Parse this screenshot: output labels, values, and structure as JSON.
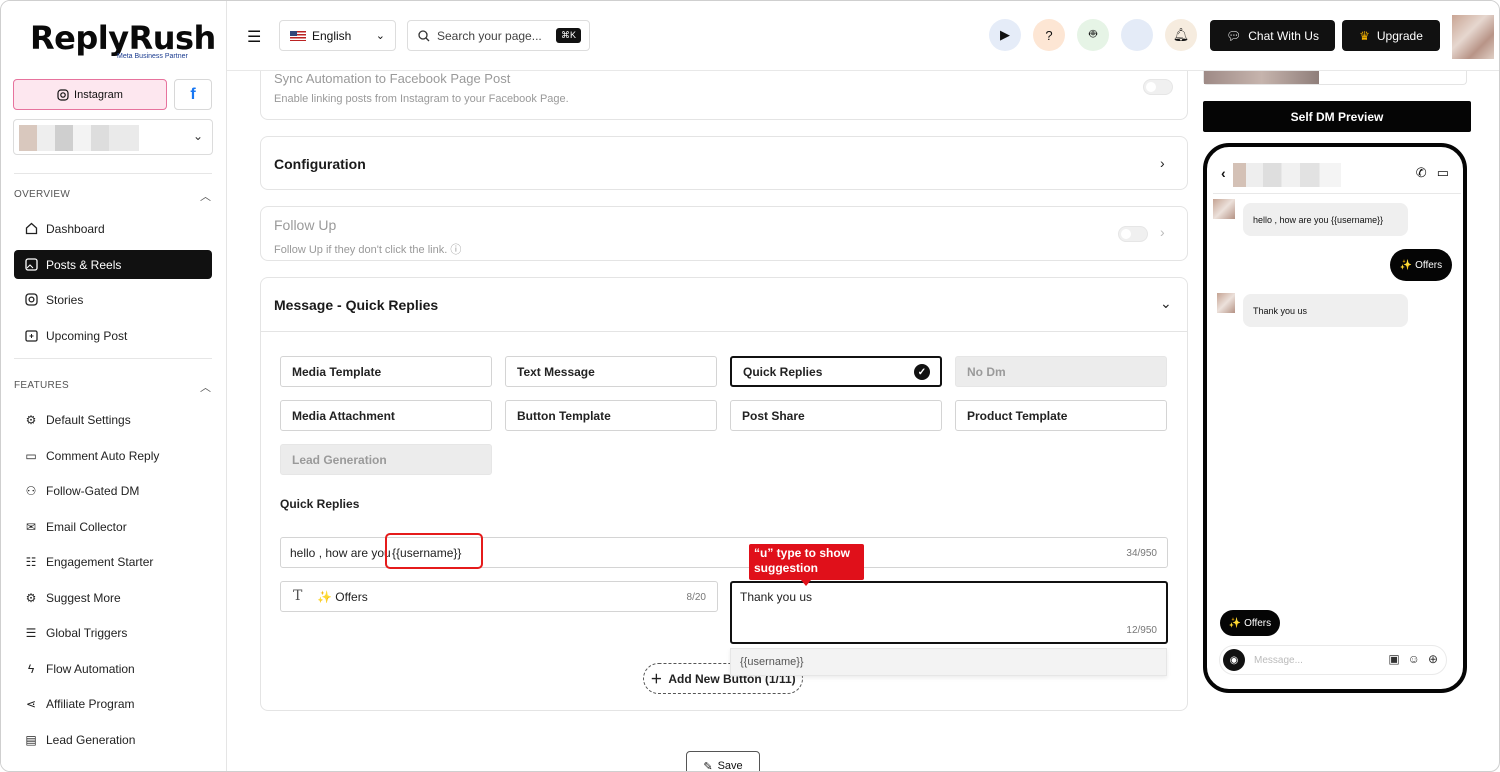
{
  "brand": {
    "name": "ReplyRush",
    "sub": "Meta Business Partner"
  },
  "sidebar": {
    "platform_instagram": "Instagram",
    "platform_facebook": "f",
    "sections": [
      {
        "title": "OVERVIEW"
      },
      {
        "title": "FEATURES"
      }
    ],
    "overview": [
      {
        "label": "Dashboard",
        "icon": "home-icon"
      },
      {
        "label": "Posts & Reels",
        "icon": "image-icon",
        "active": true
      },
      {
        "label": "Stories",
        "icon": "instagram-icon"
      },
      {
        "label": "Upcoming Post",
        "icon": "calendar-icon"
      }
    ],
    "features": [
      {
        "label": "Default Settings",
        "icon": "gear-icon"
      },
      {
        "label": "Comment Auto Reply",
        "icon": "comment-icon"
      },
      {
        "label": "Follow-Gated DM",
        "icon": "users-icon"
      },
      {
        "label": "Email Collector",
        "icon": "mail-icon"
      },
      {
        "label": "Engagement Starter",
        "icon": "chat-icon"
      },
      {
        "label": "Suggest More",
        "icon": "gear-icon"
      },
      {
        "label": "Global Triggers",
        "icon": "list-icon"
      },
      {
        "label": "Flow Automation",
        "icon": "bolt-icon"
      },
      {
        "label": "Affiliate Program",
        "icon": "share-icon"
      },
      {
        "label": "Lead Generation",
        "icon": "doc-icon"
      }
    ]
  },
  "topbar": {
    "language": "English",
    "search_placeholder": "Search your page...",
    "shortcut": "⌘K",
    "chat_label": "Chat With Us",
    "upgrade_label": "Upgrade"
  },
  "sync": {
    "title": "Sync Automation to Facebook Page Post",
    "subtitle": "Enable linking posts from Instagram to your Facebook Page."
  },
  "configuration": {
    "title": "Configuration"
  },
  "followup": {
    "title": "Follow Up",
    "subtitle": "Follow Up if they don't click the link."
  },
  "message": {
    "title": "Message - Quick Replies",
    "options": [
      {
        "label": "Media Template",
        "state": "normal"
      },
      {
        "label": "Text Message",
        "state": "normal"
      },
      {
        "label": "Quick Replies",
        "state": "selected"
      },
      {
        "label": "No Dm",
        "state": "disabled"
      },
      {
        "label": "Media Attachment",
        "state": "normal"
      },
      {
        "label": "Button Template",
        "state": "normal"
      },
      {
        "label": "Post Share",
        "state": "normal"
      },
      {
        "label": "Product Template",
        "state": "normal"
      },
      {
        "label": "Lead Generation",
        "state": "disabled"
      }
    ],
    "quick_replies_label": "Quick Replies",
    "message_prefix": "hello , how are you",
    "message_var": "{{username}}",
    "message_counter": "34/950",
    "button_text": "✨ Offers",
    "button_counter": "8/20",
    "reply_text": "Thank you us",
    "reply_counter": "12/950",
    "annotation": "“u” type to show suggestion",
    "suggestion": "{{username}}",
    "add_button": "Add New Button (1/11)",
    "save": "Save"
  },
  "preview": {
    "button": "Self DM Preview",
    "msg_in_1": "hello , how are you {{username}}",
    "msg_out": "✨ Offers",
    "msg_in_2": "Thank you us",
    "quick_reply": "✨ Offers",
    "input_placeholder": "Message..."
  }
}
